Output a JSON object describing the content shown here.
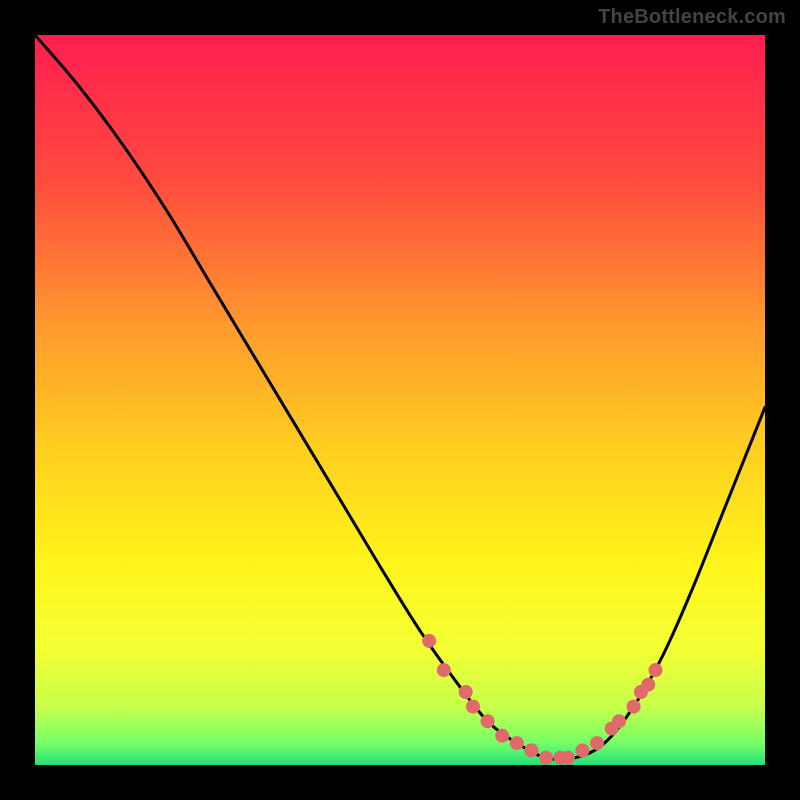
{
  "watermark": "TheBottleneck.com",
  "chart_data": {
    "type": "line",
    "title": "",
    "xlabel": "",
    "ylabel": "",
    "xlim": [
      0,
      100
    ],
    "ylim": [
      0,
      100
    ],
    "grid": false,
    "legend": false,
    "background_gradient": {
      "stops": [
        {
          "offset": 0.0,
          "color": "#ff1e50"
        },
        {
          "offset": 0.2,
          "color": "#ff4b3e"
        },
        {
          "offset": 0.4,
          "color": "#ff9a2e"
        },
        {
          "offset": 0.58,
          "color": "#ffd21f"
        },
        {
          "offset": 0.72,
          "color": "#fff41a"
        },
        {
          "offset": 0.84,
          "color": "#f4ff33"
        },
        {
          "offset": 0.92,
          "color": "#c7ff4a"
        },
        {
          "offset": 0.97,
          "color": "#76ff67"
        },
        {
          "offset": 1.0,
          "color": "#22e07a"
        }
      ]
    },
    "series": [
      {
        "name": "bottleneck-curve",
        "color": "#000000",
        "x": [
          0,
          6,
          12,
          18,
          24,
          30,
          36,
          42,
          48,
          53,
          58,
          62,
          66,
          70,
          74,
          78,
          82,
          86,
          90,
          94,
          98,
          100
        ],
        "y": [
          100,
          93,
          85,
          76,
          66,
          56,
          46,
          36,
          26,
          18,
          11,
          6,
          3,
          1,
          1,
          3,
          8,
          15,
          24,
          34,
          44,
          49
        ]
      }
    ],
    "markers": {
      "color": "#e06a6a",
      "radius": 7,
      "points": [
        {
          "x": 54,
          "y": 17
        },
        {
          "x": 56,
          "y": 13
        },
        {
          "x": 59,
          "y": 10
        },
        {
          "x": 60,
          "y": 8
        },
        {
          "x": 62,
          "y": 6
        },
        {
          "x": 64,
          "y": 4
        },
        {
          "x": 66,
          "y": 3
        },
        {
          "x": 68,
          "y": 2
        },
        {
          "x": 70,
          "y": 1
        },
        {
          "x": 72,
          "y": 1
        },
        {
          "x": 73,
          "y": 1
        },
        {
          "x": 75,
          "y": 2
        },
        {
          "x": 77,
          "y": 3
        },
        {
          "x": 79,
          "y": 5
        },
        {
          "x": 80,
          "y": 6
        },
        {
          "x": 82,
          "y": 8
        },
        {
          "x": 83,
          "y": 10
        },
        {
          "x": 84,
          "y": 11
        },
        {
          "x": 85,
          "y": 13
        }
      ]
    }
  }
}
